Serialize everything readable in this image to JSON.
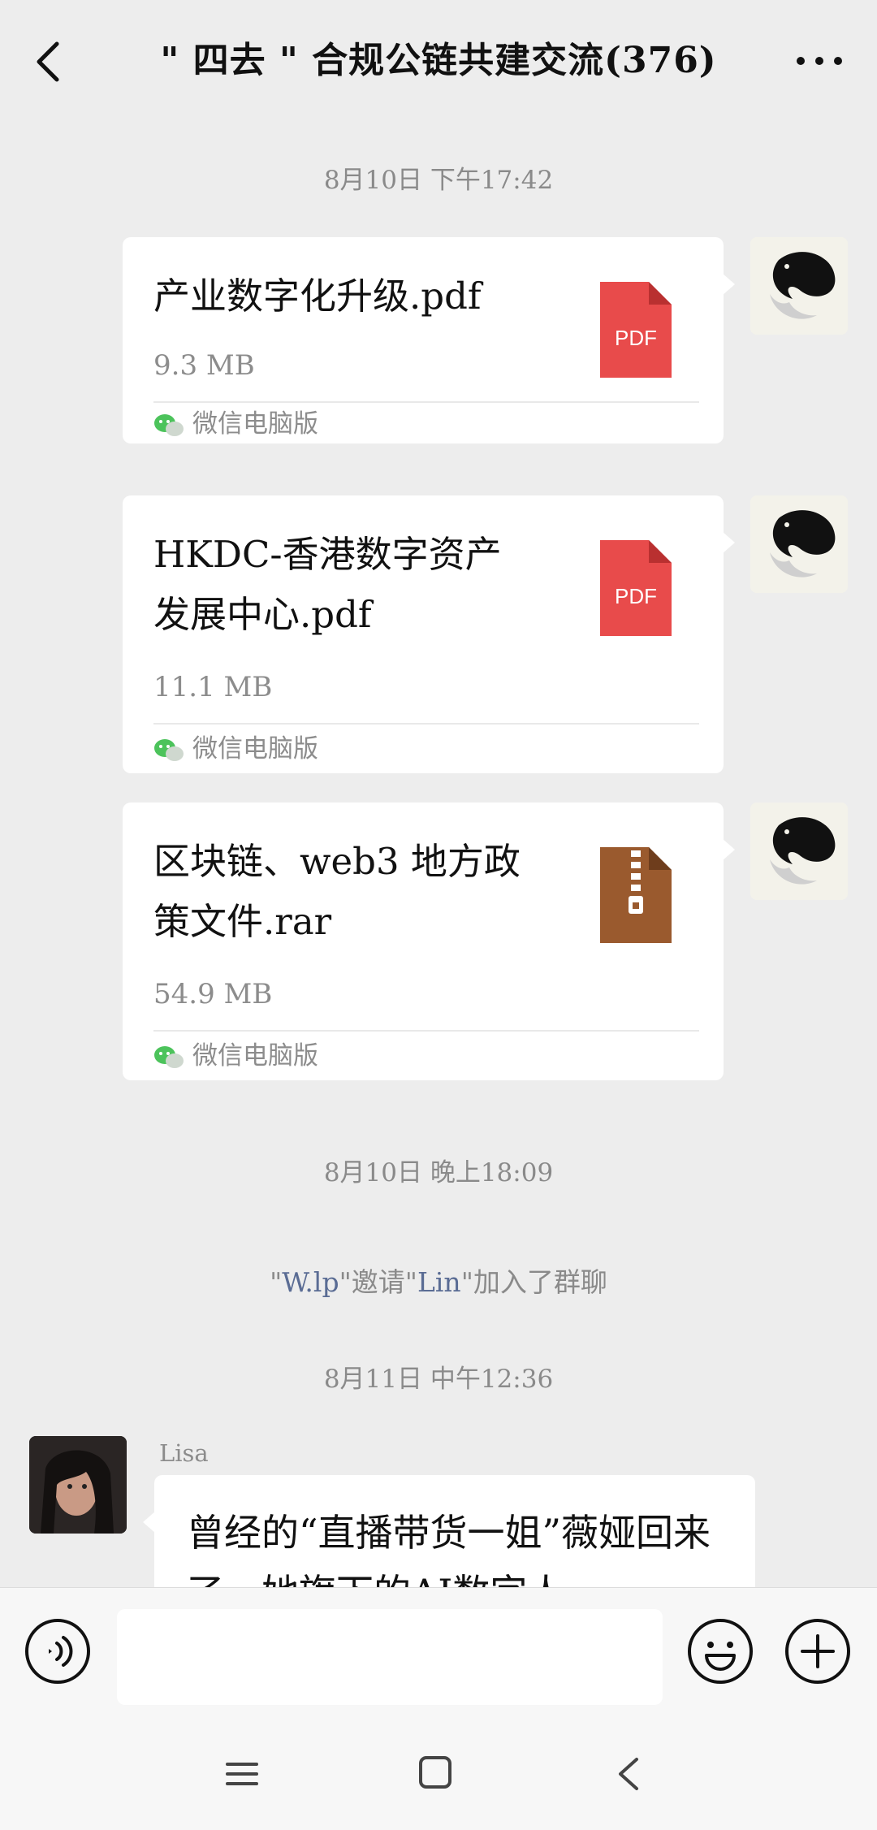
{
  "header": {
    "title": "\" 四去 \" 合规公链共建交流(376)",
    "back_icon": "chevron-left-icon",
    "more_icon": "more-dots-icon"
  },
  "timestamps": [
    "8月10日  下午17:42",
    "8月10日  晚上18:09",
    "8月11日  中午12:36"
  ],
  "files": [
    {
      "name": "产业数字化升级.pdf",
      "size": "9.3 MB",
      "type": "PDF",
      "source": "微信电脑版"
    },
    {
      "name": "HKDC-香港数字资产发展中心.pdf",
      "size": "11.1 MB",
      "type": "PDF",
      "source": "微信电脑版"
    },
    {
      "name": "区块链、web3 地方政策文件.rar",
      "size": "54.9 MB",
      "type": "RAR",
      "source": "微信电脑版"
    }
  ],
  "system_message": {
    "q1": "\"",
    "inviter": "W.lp",
    "q2": "\"邀请\"",
    "invitee": "Lin",
    "q3": "\"加入了群聊"
  },
  "message": {
    "sender": "Lisa",
    "text": "曾经的“直播带货一姐”薇娅回来了，她旗下的AI数字人..."
  },
  "input": {
    "value": "",
    "placeholder": ""
  },
  "colors": {
    "background": "#ededed",
    "pdf_red": "#e84b4b",
    "archive_brown": "#9a5a2e",
    "link_blue": "#5a6c94"
  }
}
